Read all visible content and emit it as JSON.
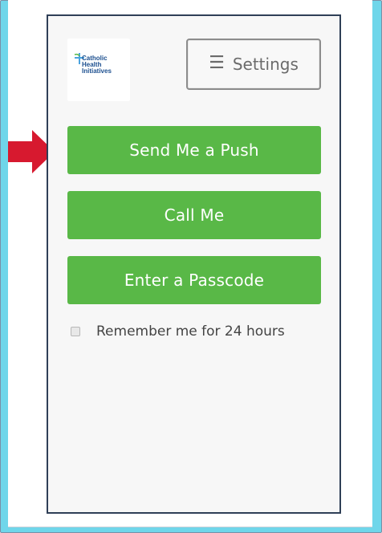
{
  "app": {
    "brand_name": "Catholic Health Initiatives"
  },
  "header": {
    "settings_label": "Settings",
    "menu_icon": "☰"
  },
  "actions": {
    "push": "Send Me a Push",
    "call": "Call Me",
    "passcode": "Enter a Passcode"
  },
  "remember": {
    "label": "Remember me for 24 hours",
    "checked": false
  },
  "colors": {
    "accent_green": "#59b847",
    "frame_blue": "#6fd6ea",
    "arrow_red": "#d7192f"
  },
  "icons": {
    "logo": "catholic-health-logo-icon",
    "menu": "hamburger-menu-icon",
    "arrow": "red-arrow-icon"
  }
}
